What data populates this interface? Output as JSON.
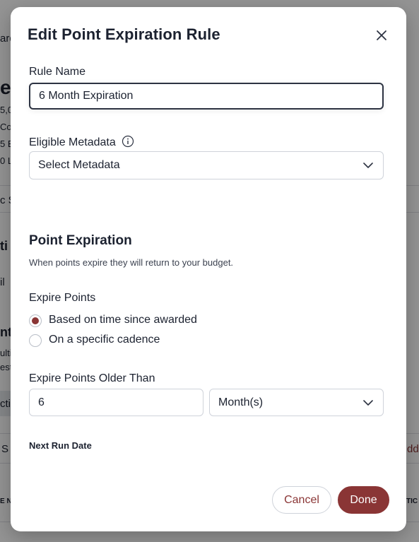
{
  "background": {
    "fragments": [
      "ard",
      "er",
      "5,0",
      "Co",
      "5 E",
      "0 L",
      "c S",
      "ti",
      "il",
      "nt",
      "ulti",
      "est",
      "cti",
      "S",
      "dd",
      "E N",
      "TIC"
    ]
  },
  "modal": {
    "title": "Edit Point Expiration Rule",
    "close_icon": "close-icon",
    "rule_name": {
      "label": "Rule Name",
      "value": "6 Month Expiration"
    },
    "eligible_metadata": {
      "label": "Eligible Metadata",
      "info_icon": "info-icon",
      "selected": "Select Metadata"
    },
    "point_expiration": {
      "title": "Point Expiration",
      "description": "When points expire they will return to your budget."
    },
    "expire_points": {
      "label": "Expire Points",
      "options": [
        {
          "label": "Based on time since awarded",
          "selected": true
        },
        {
          "label": "On a specific cadence",
          "selected": false
        }
      ]
    },
    "older_than": {
      "label": "Expire Points Older Than",
      "value": "6",
      "unit": "Month(s)"
    },
    "next_run_date": {
      "label": "Next Run Date"
    },
    "buttons": {
      "cancel": "Cancel",
      "done": "Done"
    }
  },
  "colors": {
    "accent": "#8a3535",
    "text": "#1c2230",
    "border": "#cfd3da"
  }
}
